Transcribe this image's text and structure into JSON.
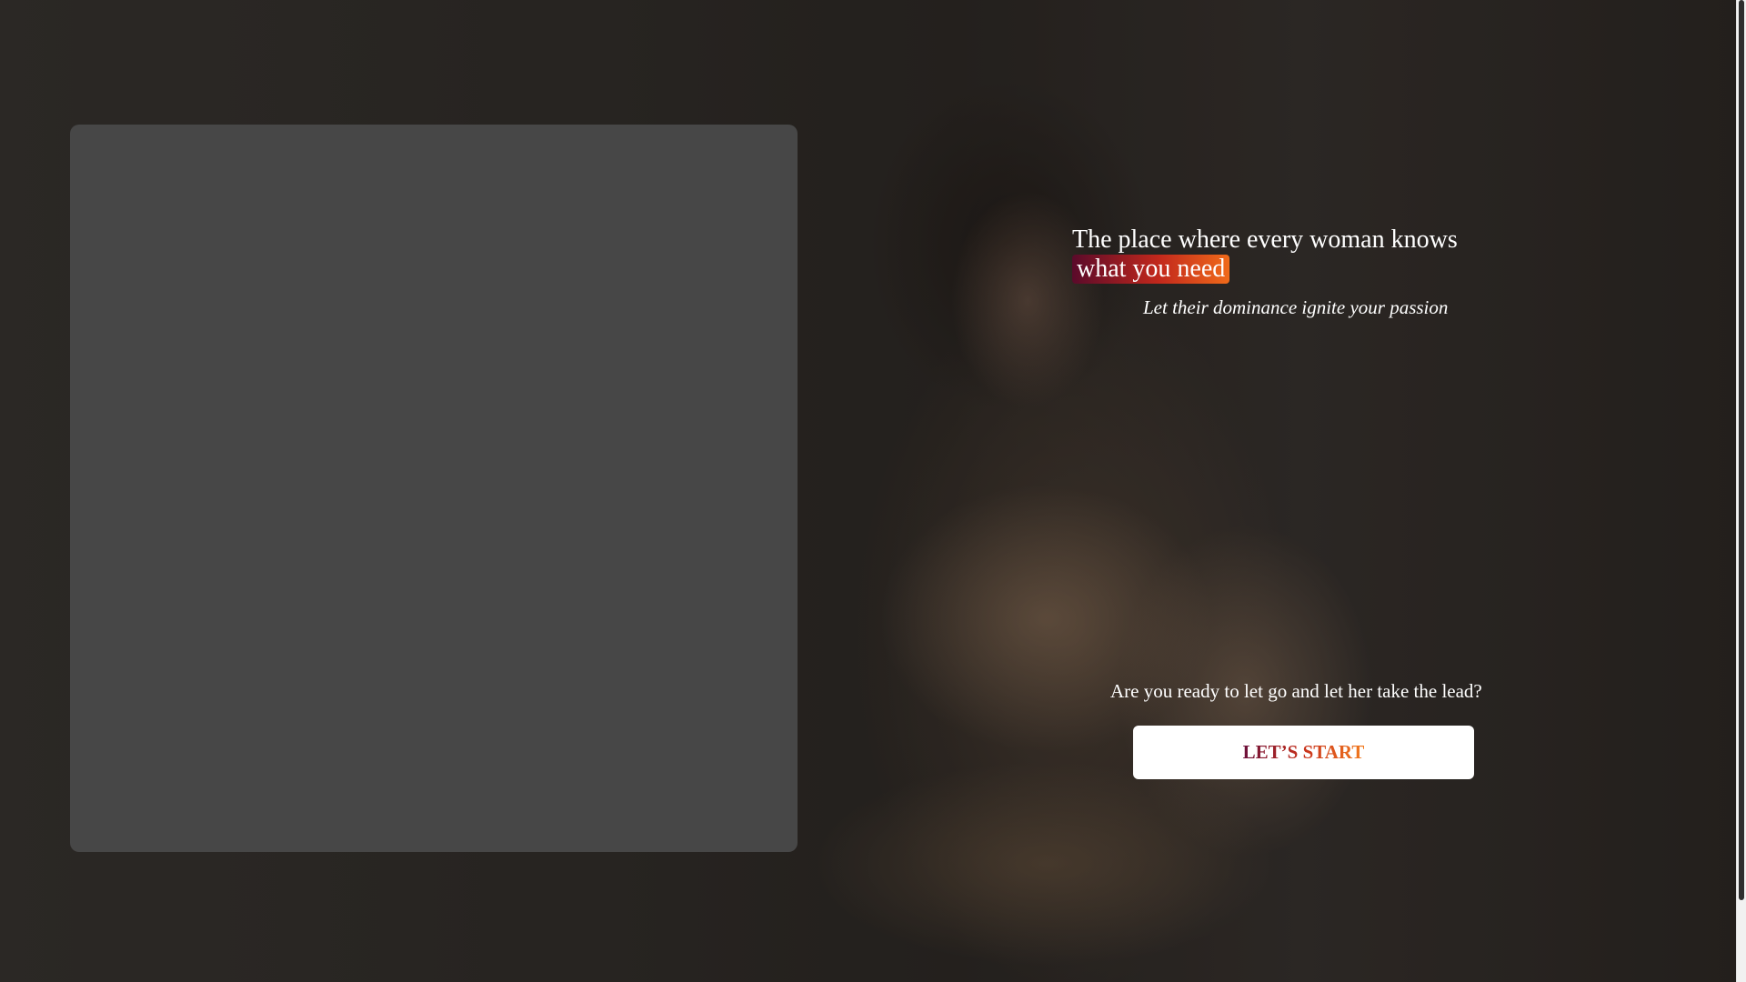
{
  "hero": {
    "title_line1": "The place where every woman knows",
    "title_highlight": "what you need",
    "subtitle": "Let their dominance ignite your passion"
  },
  "cta": {
    "question": "Are you ready to let go and let her take the lead?",
    "button_label": "LET’S START"
  },
  "colors": {
    "highlight_gradient_start": "#5a0a2a",
    "highlight_gradient_mid": "#c2281c",
    "highlight_gradient_end": "#f06a1a",
    "video_panel": "#474747"
  }
}
